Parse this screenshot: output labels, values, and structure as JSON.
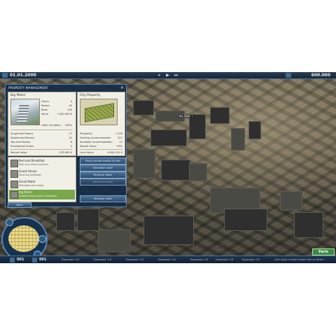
{
  "topbar": {
    "date": "01.01.2000",
    "controls": [
      "⏸",
      "▶",
      "⏭"
    ],
    "money": "600.000"
  },
  "panel": {
    "title": "PROPERTY MANAGEMENT",
    "close": "×",
    "hotel": {
      "name": "Big Motel",
      "stats": [
        {
          "label": "Floors",
          "value": "4"
        },
        {
          "label": "Rooms",
          "value": "40"
        },
        {
          "label": "Beds",
          "value": "100"
        },
        {
          "label": "Value",
          "value": "1.000.000 €"
        }
      ],
      "condition_label": "Hotel Condition",
      "condition_value": "100%",
      "rooms": [
        {
          "label": "Single-bed Rooms",
          "value": "17"
        },
        {
          "label": "Double-bed Rooms",
          "value": "12"
        },
        {
          "label": "Two-bed Rooms",
          "value": "6"
        },
        {
          "label": "Presidential Suites",
          "value": "5"
        }
      ],
      "market_label": "Market Value",
      "market_value": "470.000 €"
    },
    "property": {
      "name": "City Property",
      "stats": [
        {
          "label": "Prosperity",
          "value": "1.228"
        },
        {
          "label": "Existing Accommodation",
          "value": "207"
        },
        {
          "label": "Available Accommodation",
          "value": "12"
        },
        {
          "label": "Market Share",
          "value": "59%"
        }
      ],
      "land_label": "Land Value",
      "land_value": "4.634.231 €"
    },
    "types": [
      {
        "name": "Bed and Breakfast",
        "desc": "Start your family business.",
        "selected": false
      },
      {
        "name": "Guest House",
        "desc": "Small but profitable.",
        "selected": false
      },
      {
        "name": "Small Motel",
        "desc": "Affordable and simple.",
        "selected": false
      },
      {
        "name": "Big Motel",
        "desc": "Growing beyond your competition.",
        "selected": true
      }
    ],
    "buttons": [
      {
        "label": "Drop private assets to this property",
        "enabled": true
      },
      {
        "label": "Demolish hotel",
        "enabled": true
      },
      {
        "label": "Rename hotel",
        "enabled": true
      },
      {
        "label": "Renovate hotel",
        "enabled": false
      },
      {
        "label": "Manage hotel",
        "enabled": true
      }
    ],
    "back": "Back"
  },
  "map": {
    "hotel_tag": "Big Motel 1"
  },
  "bottombar": {
    "count_left": "001",
    "count_right": "001",
    "ticker": [
      "Expenses: 0 €",
      "Expenses: 0 €",
      "Expenses: 0 €",
      "Expenses: 0 €",
      "Expenses: 0 €",
      "Expenses: 0 €",
      "Expenses: 0 €",
      "Let's build a hotel empire like no other!"
    ],
    "city": "Paris"
  }
}
